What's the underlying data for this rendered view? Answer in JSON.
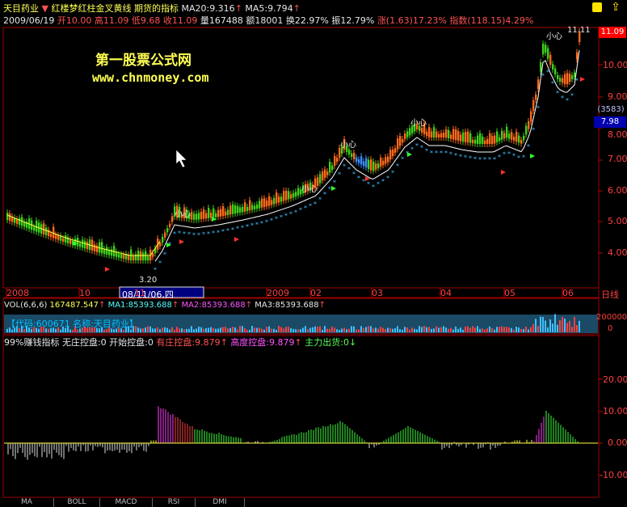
{
  "title_bar": {
    "stock_name": "天目药业",
    "indicator_name": "红楼梦红柱金叉黄线 期货的指标",
    "ma20": "MA20:9.316",
    "ma5": "MA5:9.794"
  },
  "quote": {
    "date": "2009/06/19",
    "open": "开10.00",
    "high": "高11.09",
    "low": "低9.68",
    "close": "收11.09",
    "volume": "量167488",
    "amount": "额18001",
    "turnover": "换22.97%",
    "amplitude": "振12.79%",
    "change": "涨(1.63)17.23%",
    "index": "指数(118.15)4.29%"
  },
  "watermark": {
    "line1": "第一股票公式网",
    "line2": "www.chnmoney.com"
  },
  "price_chart": {
    "high_label": "11.11",
    "low_label": "3.20",
    "current_price": "11.09",
    "code_box": "(3583)",
    "cursor_price": "7.98",
    "y_ticks": [
      "11.09",
      "10.00",
      "9.00",
      "8.00",
      "7.00",
      "6.00",
      "5.00",
      "4.00"
    ],
    "annotations": [
      "小心",
      "小心",
      "小心",
      "小心",
      "小心"
    ]
  },
  "time_axis": {
    "labels": [
      "2008",
      "10",
      "11",
      "08/11/06,四",
      "2009",
      "02",
      "03",
      "04",
      "05",
      "06"
    ],
    "right_label": "日线"
  },
  "volume_panel": {
    "header_name": "VOL(6,6,6)",
    "header_value": "167487.547",
    "ma1": "MA1:85393.688",
    "ma2": "MA2:85393.688",
    "ma3": "MA3:85393.688",
    "code_label": "【代码:600671 名称:天目药业】",
    "y_ticks": [
      "200000",
      "0"
    ]
  },
  "indicator_panel": {
    "name": "99%赚钱指标",
    "wuzhuang": "无庄控盘:0",
    "kaishi": "开始控盘:0",
    "youzhuang": "有庄控盘:9.879",
    "gaodu": "高度控盘:9.879",
    "zhuli": "主力出货:0",
    "y_ticks": [
      "20.00",
      "10.00",
      "0.00",
      "-10.00"
    ]
  },
  "tabs": [
    "MA",
    "BOLL",
    "MACD",
    "RSI",
    "DMI"
  ],
  "colors": {
    "up": "#ff6a1a",
    "down": "#3fd01c",
    "axis": "#c00000",
    "text": "#ffff54"
  }
}
